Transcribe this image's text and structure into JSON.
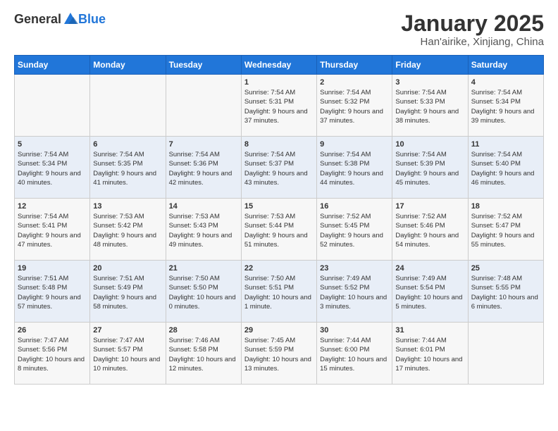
{
  "header": {
    "logo_general": "General",
    "logo_blue": "Blue",
    "title": "January 2025",
    "subtitle": "Han'airike, Xinjiang, China"
  },
  "days_of_week": [
    "Sunday",
    "Monday",
    "Tuesday",
    "Wednesday",
    "Thursday",
    "Friday",
    "Saturday"
  ],
  "weeks": [
    [
      {
        "num": "",
        "info": ""
      },
      {
        "num": "",
        "info": ""
      },
      {
        "num": "",
        "info": ""
      },
      {
        "num": "1",
        "info": "Sunrise: 7:54 AM\nSunset: 5:31 PM\nDaylight: 9 hours and 37 minutes."
      },
      {
        "num": "2",
        "info": "Sunrise: 7:54 AM\nSunset: 5:32 PM\nDaylight: 9 hours and 37 minutes."
      },
      {
        "num": "3",
        "info": "Sunrise: 7:54 AM\nSunset: 5:33 PM\nDaylight: 9 hours and 38 minutes."
      },
      {
        "num": "4",
        "info": "Sunrise: 7:54 AM\nSunset: 5:34 PM\nDaylight: 9 hours and 39 minutes."
      }
    ],
    [
      {
        "num": "5",
        "info": "Sunrise: 7:54 AM\nSunset: 5:34 PM\nDaylight: 9 hours and 40 minutes."
      },
      {
        "num": "6",
        "info": "Sunrise: 7:54 AM\nSunset: 5:35 PM\nDaylight: 9 hours and 41 minutes."
      },
      {
        "num": "7",
        "info": "Sunrise: 7:54 AM\nSunset: 5:36 PM\nDaylight: 9 hours and 42 minutes."
      },
      {
        "num": "8",
        "info": "Sunrise: 7:54 AM\nSunset: 5:37 PM\nDaylight: 9 hours and 43 minutes."
      },
      {
        "num": "9",
        "info": "Sunrise: 7:54 AM\nSunset: 5:38 PM\nDaylight: 9 hours and 44 minutes."
      },
      {
        "num": "10",
        "info": "Sunrise: 7:54 AM\nSunset: 5:39 PM\nDaylight: 9 hours and 45 minutes."
      },
      {
        "num": "11",
        "info": "Sunrise: 7:54 AM\nSunset: 5:40 PM\nDaylight: 9 hours and 46 minutes."
      }
    ],
    [
      {
        "num": "12",
        "info": "Sunrise: 7:54 AM\nSunset: 5:41 PM\nDaylight: 9 hours and 47 minutes."
      },
      {
        "num": "13",
        "info": "Sunrise: 7:53 AM\nSunset: 5:42 PM\nDaylight: 9 hours and 48 minutes."
      },
      {
        "num": "14",
        "info": "Sunrise: 7:53 AM\nSunset: 5:43 PM\nDaylight: 9 hours and 49 minutes."
      },
      {
        "num": "15",
        "info": "Sunrise: 7:53 AM\nSunset: 5:44 PM\nDaylight: 9 hours and 51 minutes."
      },
      {
        "num": "16",
        "info": "Sunrise: 7:52 AM\nSunset: 5:45 PM\nDaylight: 9 hours and 52 minutes."
      },
      {
        "num": "17",
        "info": "Sunrise: 7:52 AM\nSunset: 5:46 PM\nDaylight: 9 hours and 54 minutes."
      },
      {
        "num": "18",
        "info": "Sunrise: 7:52 AM\nSunset: 5:47 PM\nDaylight: 9 hours and 55 minutes."
      }
    ],
    [
      {
        "num": "19",
        "info": "Sunrise: 7:51 AM\nSunset: 5:48 PM\nDaylight: 9 hours and 57 minutes."
      },
      {
        "num": "20",
        "info": "Sunrise: 7:51 AM\nSunset: 5:49 PM\nDaylight: 9 hours and 58 minutes."
      },
      {
        "num": "21",
        "info": "Sunrise: 7:50 AM\nSunset: 5:50 PM\nDaylight: 10 hours and 0 minutes."
      },
      {
        "num": "22",
        "info": "Sunrise: 7:50 AM\nSunset: 5:51 PM\nDaylight: 10 hours and 1 minute."
      },
      {
        "num": "23",
        "info": "Sunrise: 7:49 AM\nSunset: 5:52 PM\nDaylight: 10 hours and 3 minutes."
      },
      {
        "num": "24",
        "info": "Sunrise: 7:49 AM\nSunset: 5:54 PM\nDaylight: 10 hours and 5 minutes."
      },
      {
        "num": "25",
        "info": "Sunrise: 7:48 AM\nSunset: 5:55 PM\nDaylight: 10 hours and 6 minutes."
      }
    ],
    [
      {
        "num": "26",
        "info": "Sunrise: 7:47 AM\nSunset: 5:56 PM\nDaylight: 10 hours and 8 minutes."
      },
      {
        "num": "27",
        "info": "Sunrise: 7:47 AM\nSunset: 5:57 PM\nDaylight: 10 hours and 10 minutes."
      },
      {
        "num": "28",
        "info": "Sunrise: 7:46 AM\nSunset: 5:58 PM\nDaylight: 10 hours and 12 minutes."
      },
      {
        "num": "29",
        "info": "Sunrise: 7:45 AM\nSunset: 5:59 PM\nDaylight: 10 hours and 13 minutes."
      },
      {
        "num": "30",
        "info": "Sunrise: 7:44 AM\nSunset: 6:00 PM\nDaylight: 10 hours and 15 minutes."
      },
      {
        "num": "31",
        "info": "Sunrise: 7:44 AM\nSunset: 6:01 PM\nDaylight: 10 hours and 17 minutes."
      },
      {
        "num": "",
        "info": ""
      }
    ]
  ]
}
